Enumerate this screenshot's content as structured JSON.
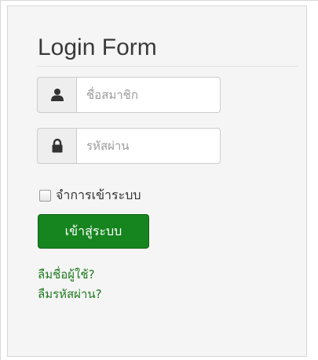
{
  "form": {
    "title": "Login Form",
    "username": {
      "icon": "user-icon",
      "placeholder": "ชื่อสมาชิก"
    },
    "password": {
      "icon": "lock-icon",
      "placeholder": "รหัสผ่าน"
    },
    "remember_label": "จำการเข้าระบบ",
    "remember_checked": false,
    "login_button": "เข้าสู่ระบบ",
    "forgot_username": "ลืมชื่อผู้ใช้?",
    "forgot_password": "ลืมรหัสผ่าน?"
  },
  "colors": {
    "primary_button": "#16841f",
    "link": "#1e7a1e",
    "panel_background": "#f5f5f5"
  }
}
